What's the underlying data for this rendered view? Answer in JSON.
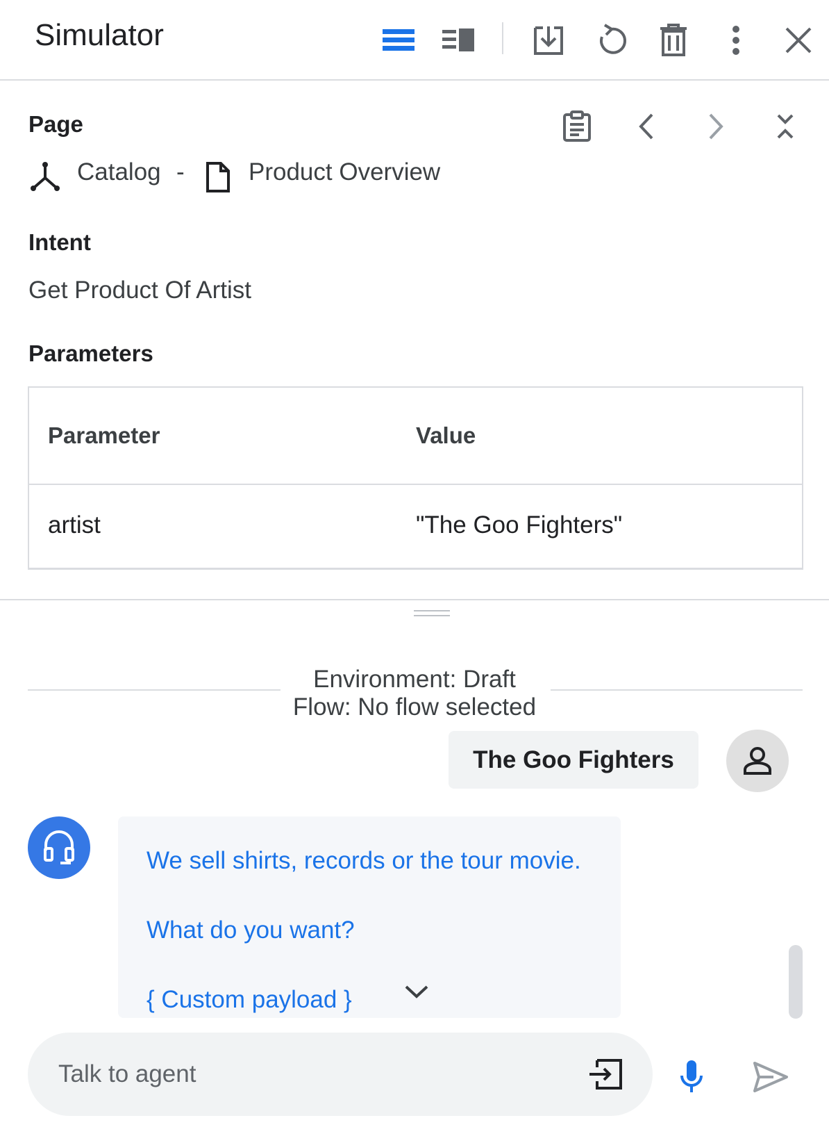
{
  "header": {
    "title": "Simulator",
    "toolbar_icons": [
      "view-list-icon",
      "view-split-icon",
      "export-icon",
      "reset-icon",
      "delete-icon",
      "more-vert-icon",
      "close-icon"
    ],
    "accent_color": "#1a73e8"
  },
  "page": {
    "section_label": "Page",
    "tool_icons": [
      "clipboard-icon",
      "chevron-left-icon",
      "chevron-right-icon",
      "collapse-icon"
    ],
    "flow_name": "Catalog",
    "separator": "-",
    "page_name": "Product Overview"
  },
  "intent": {
    "section_label": "Intent",
    "value": "Get Product Of Artist"
  },
  "parameters": {
    "section_label": "Parameters",
    "columns": [
      "Parameter",
      "Value"
    ],
    "rows": [
      {
        "parameter": "artist",
        "value": "\"The Goo Fighters\""
      }
    ]
  },
  "conversation": {
    "environment": "Environment: Draft",
    "flow": "Flow: No flow selected",
    "user_message": "The Goo Fighters",
    "agent_lines": [
      "We sell shirts, records or the tour movie.",
      "What do you want?"
    ],
    "custom_payload": "{ Custom payload }",
    "agent_color": "#3578e5"
  },
  "composer": {
    "placeholder": "Talk to agent",
    "icons": [
      "send-event-icon",
      "mic-icon",
      "send-icon"
    ]
  }
}
